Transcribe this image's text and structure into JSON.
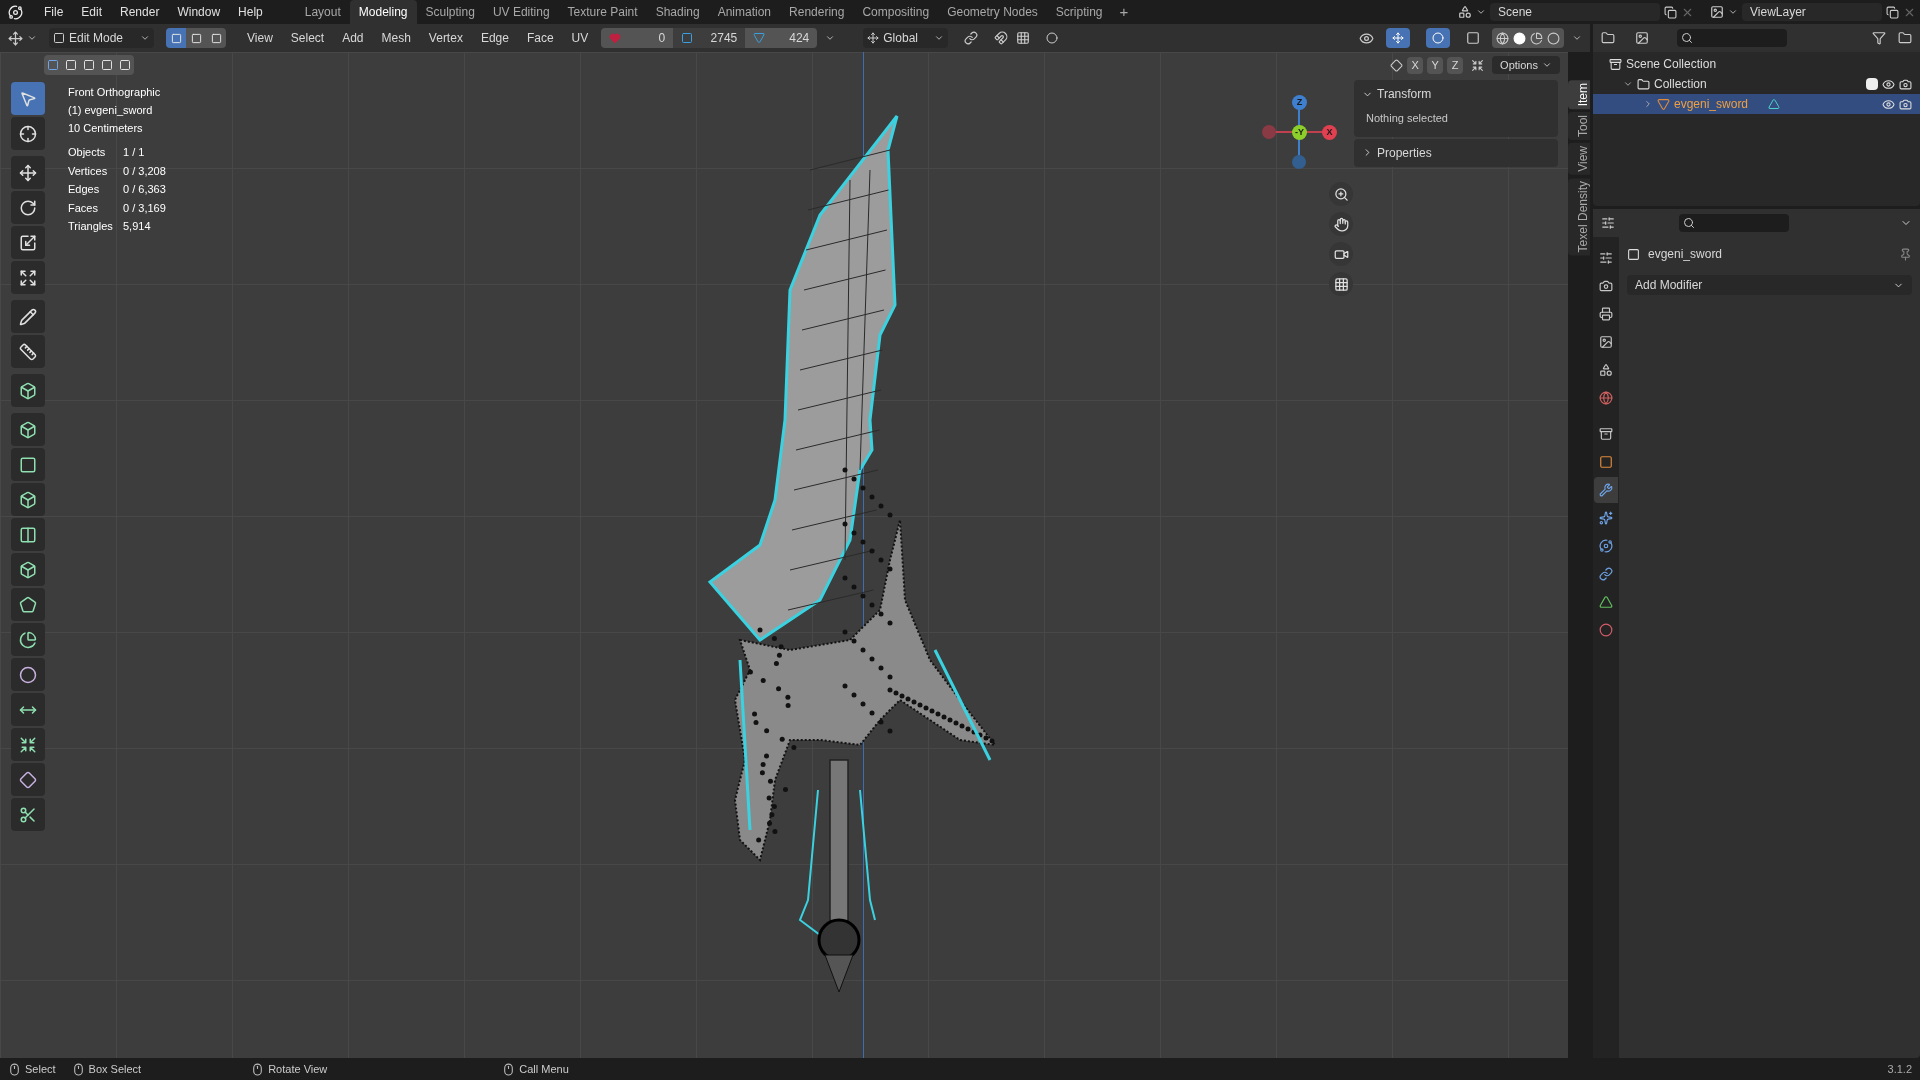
{
  "menu_bar": {
    "items": [
      "File",
      "Edit",
      "Render",
      "Window",
      "Help"
    ]
  },
  "workspaces": [
    {
      "label": "Layout",
      "selected": false
    },
    {
      "label": "Modeling",
      "selected": true
    },
    {
      "label": "Sculpting",
      "selected": false
    },
    {
      "label": "UV Editing",
      "selected": false
    },
    {
      "label": "Texture Paint",
      "selected": false
    },
    {
      "label": "Shading",
      "selected": false
    },
    {
      "label": "Animation",
      "selected": false
    },
    {
      "label": "Rendering",
      "selected": false
    },
    {
      "label": "Compositing",
      "selected": false
    },
    {
      "label": "Geometry Nodes",
      "selected": false
    },
    {
      "label": "Scripting",
      "selected": false
    }
  ],
  "add_workspace": "+",
  "scene": "Scene",
  "view_layer": "ViewLayer",
  "header": {
    "mode": "Edit Mode",
    "select_modes": [
      {
        "selected": true
      },
      {
        "selected": false
      },
      {
        "selected": false
      }
    ],
    "menus": [
      "View",
      "Select",
      "Add",
      "Mesh",
      "Vertex",
      "Edge",
      "Face",
      "UV"
    ],
    "counters": [
      "0",
      "2745",
      "424"
    ],
    "orientation": "Global"
  },
  "axis_toggles": [
    "X",
    "Y",
    "Z"
  ],
  "options": "Options",
  "overlay": {
    "lines": [
      "Front Orthographic",
      "(1) evgeni_sword",
      "10 Centimeters"
    ],
    "stats": [
      {
        "label": "Objects",
        "value": "1 / 1"
      },
      {
        "label": "Vertices",
        "value": "0 / 3,208"
      },
      {
        "label": "Edges",
        "value": "0 / 6,363"
      },
      {
        "label": "Faces",
        "value": "0 / 3,169"
      },
      {
        "label": "Triangles",
        "value": "5,914"
      }
    ]
  },
  "tools": [
    {
      "selected": true
    },
    {
      "selected": false
    },
    {
      "selected": false
    },
    {
      "selected": false
    },
    {
      "selected": false
    },
    {
      "selected": false
    },
    {
      "selected": false
    },
    {
      "selected": false
    },
    {
      "selected": false
    },
    {
      "selected": false
    },
    {
      "selected": false
    },
    {
      "selected": false
    },
    {
      "selected": false
    },
    {
      "selected": false
    },
    {
      "selected": false
    },
    {
      "selected": false
    },
    {
      "selected": false
    },
    {
      "selected": false
    },
    {
      "selected": false
    },
    {
      "selected": false
    },
    {
      "selected": false
    }
  ],
  "gizmo": [
    "Z",
    "-Y",
    "X"
  ],
  "sidebar": {
    "panels": [
      {
        "title": "Transform",
        "expanded": true,
        "body": "Nothing selected"
      },
      {
        "title": "Properties",
        "expanded": false
      }
    ],
    "tabs": [
      {
        "label": "Item",
        "selected": true
      },
      {
        "label": "Tool",
        "selected": false
      },
      {
        "label": "View",
        "selected": false
      },
      {
        "label": "Texel Density",
        "selected": false
      }
    ]
  },
  "outliner": {
    "tree": [
      {
        "label": "Scene Collection",
        "children": [
          {
            "label": "Collection",
            "expanded": true,
            "checked": true,
            "children": [
              {
                "label": "evgeni_sword",
                "selected": true,
                "expanded": false
              }
            ]
          }
        ]
      }
    ]
  },
  "properties": {
    "tabs": [
      {
        "selected": false
      },
      {
        "selected": false
      },
      {
        "selected": false
      },
      {
        "selected": false
      },
      {
        "selected": false
      },
      {
        "selected": false
      },
      {
        "selected": false
      },
      {
        "selected": false
      },
      {
        "selected": true
      },
      {
        "selected": false
      },
      {
        "selected": false
      },
      {
        "selected": false
      },
      {
        "selected": false
      },
      {
        "selected": false
      }
    ],
    "object_name": "evgeni_sword",
    "add_modifier": "Add Modifier"
  },
  "status_bar": {
    "hints": [
      "Select",
      "Box Select",
      "Rotate View",
      "Call Menu"
    ],
    "version": "3.1.2"
  }
}
